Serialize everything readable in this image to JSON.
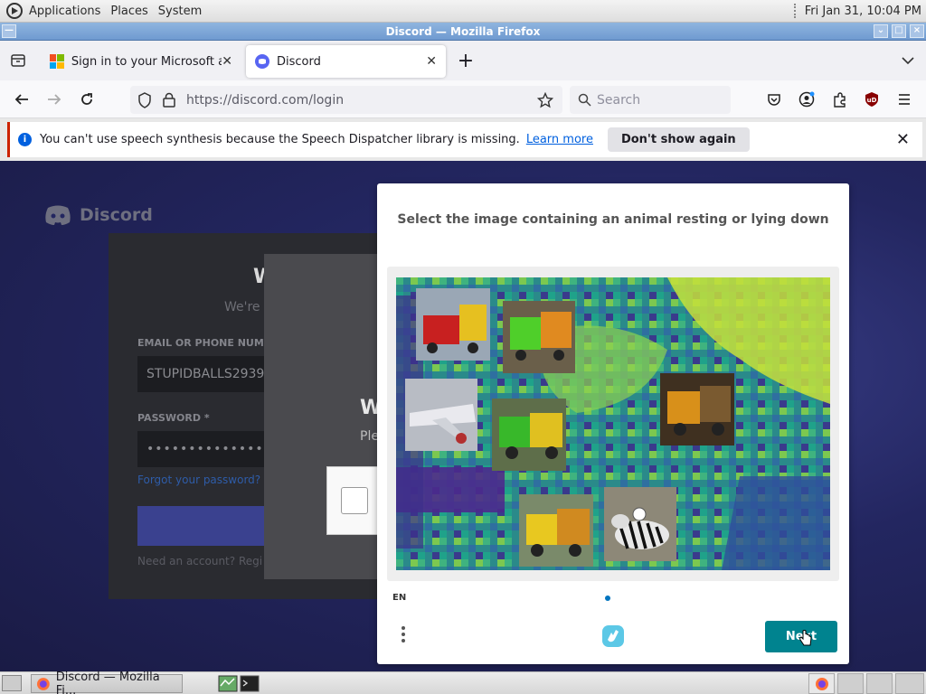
{
  "top_panel": {
    "menus": [
      "Applications",
      "Places",
      "System"
    ],
    "clock": "Fri Jan 31, 10:04 PM"
  },
  "window": {
    "title": "Discord — Mozilla Firefox"
  },
  "tabs": [
    {
      "label": "Sign in to your Microsoft acc",
      "active": false
    },
    {
      "label": "Discord",
      "active": true
    }
  ],
  "navbar": {
    "url": "https://discord.com/login",
    "search_placeholder": "Search"
  },
  "notification": {
    "message": "You can't use speech synthesis because the Speech Dispatcher library is missing.",
    "learn_more": "Learn more",
    "dont_show": "Don't show again"
  },
  "discord_page": {
    "brand": "Discord",
    "heading_partial": "W",
    "subheading_partial": "We're",
    "email_label_partial": "EMAIL OR PHONE NUMBE",
    "email_value_partial": "STUPIDBALLS2939",
    "password_label": "PASSWORD *",
    "password_value": "••••••••••••••",
    "forgot_partial": "Forgot your password?",
    "register_partial": "Need an account? Regi",
    "overlay_heading_partial": "W",
    "overlay_sub_partial": "Ple"
  },
  "captcha": {
    "prompt": "Select the image containing an animal resting or lying down",
    "language": "EN",
    "next_label": "Next"
  },
  "taskbar": {
    "window_item": "Discord — Mozilla Fi..."
  }
}
